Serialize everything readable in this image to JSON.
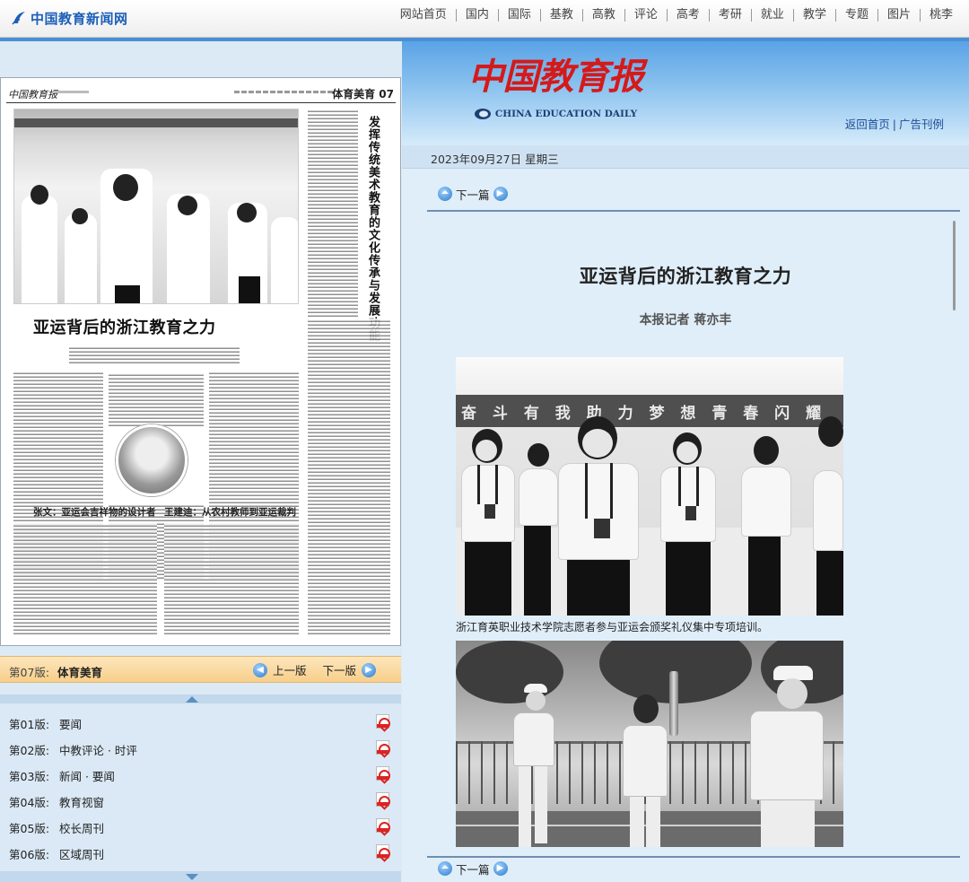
{
  "site": {
    "name": "中国教育新闻网"
  },
  "topnav": [
    "网站首页",
    "国内",
    "国际",
    "基教",
    "高教",
    "评论",
    "高考",
    "考研",
    "就业",
    "教学",
    "专题",
    "图片",
    "桃李"
  ],
  "paper": {
    "name_cn": "中国教育报",
    "name_en": "CHINA EDUCATION DAILY"
  },
  "header_links": {
    "home": "返回首页",
    "ads": "广告刊例"
  },
  "page_thumb": {
    "masthead_logo": "中国教育报",
    "section": "体育美育 07",
    "headline": "亚运背后的浙江教育之力",
    "vertical_title": "发挥传统美术教育的文化传承与发展功能",
    "sub1": "张文：亚运会吉祥物的设计者",
    "sub2": "王建迪：从农村教师到亚运裁判"
  },
  "section_bar": {
    "number": "第07版:",
    "name": "体育美育",
    "prev": "上一版",
    "next": "下一版"
  },
  "editions": [
    {
      "number": "第01版:",
      "name": "要闻"
    },
    {
      "number": "第02版:",
      "name": "中教评论 · 时评"
    },
    {
      "number": "第03版:",
      "name": "新闻 · 要闻"
    },
    {
      "number": "第04版:",
      "name": "教育视窗"
    },
    {
      "number": "第05版:",
      "name": "校长周刊"
    },
    {
      "number": "第06版:",
      "name": "区域周刊"
    }
  ],
  "date_bar": "2023年09月27日 星期三",
  "article_nav": {
    "next": "下一篇"
  },
  "article": {
    "title": "亚运背后的浙江教育之力",
    "byline": "本报记者 蒋亦丰",
    "photo1_banner": "奋 斗 有 我   助 力 梦 想   青 春 闪 耀",
    "caption1": "浙江育英职业技术学院志愿者参与亚运会颁奖礼仪集中专项培训。"
  },
  "colors": {
    "brand_blue": "#1c5fb8",
    "paper_red": "#d41a1a",
    "section_bar": "#f7cf8a",
    "panel_bg": "#e0eef9"
  }
}
